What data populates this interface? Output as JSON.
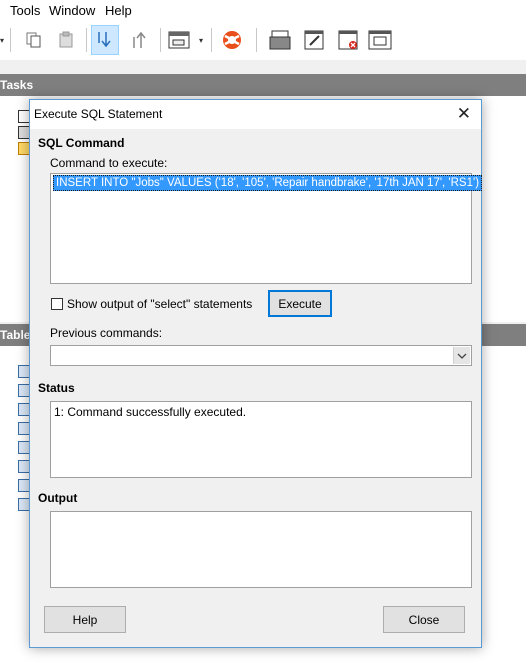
{
  "menu": {
    "tools_label": "Tools",
    "window_label": "Window",
    "help_label": "Help"
  },
  "panes": {
    "tasks_label": "Tasks",
    "tables_label": "Tables"
  },
  "dialog": {
    "title": "Execute SQL Statement",
    "sql_command_heading": "SQL Command",
    "command_label": "Command to execute:",
    "command_value": "INSERT INTO \"Jobs\" VALUES ('18', '105', 'Repair handbrake', '17th JAN 17', 'RS1')",
    "show_output_label": "Show output of \"select\" statements",
    "show_output_checked": false,
    "execute_label": "Execute",
    "previous_commands_label": "Previous commands:",
    "previous_commands_value": "",
    "status_heading": "Status",
    "status_text": "1: Command successfully executed.",
    "output_heading": "Output",
    "output_text": "",
    "help_label": "Help",
    "close_label": "Close"
  },
  "colors": {
    "selection": "#3399ff",
    "pane_header": "#7f7f7f",
    "dialog_border": "#5a9bd5",
    "default_button_border": "#0078d7"
  }
}
